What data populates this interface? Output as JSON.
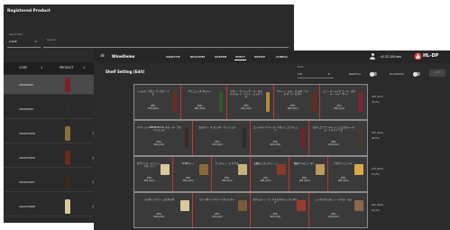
{
  "back_window": {
    "title": "Registered Product",
    "filter": {
      "type_label": "Search Field",
      "type_value": "CODE",
      "search_placeholder": "Search"
    },
    "table": {
      "columns": [
        "CODE",
        "PRODUCT"
      ],
      "rows": [
        {
          "code": "230400003",
          "name": "",
          "color": "#7a1f2b"
        },
        {
          "code": "230400005",
          "name": "",
          "color": "#2c2c2c"
        },
        {
          "code": "2022070008",
          "name": "アメリ",
          "color": "#8b6f3a"
        },
        {
          "code": "2022070006",
          "name": "スノイ",
          "color": "#6b2a1e"
        },
        {
          "code": "2022070007",
          "name": "カスデ",
          "color": "#3a2a1e"
        },
        {
          "code": "2022070008",
          "name": "カスデ",
          "color": "#d9c89a"
        }
      ]
    }
  },
  "front_window": {
    "app_title": "WineDemo",
    "nav": [
      "ANALYTIC",
      "REALTIME",
      "SCREEN",
      "SHELF",
      "DEVICE",
      "CONFIG"
    ],
    "active_nav": "SHELF",
    "user": "v2.33.105-dev",
    "brand": "HL-DP",
    "brand_color": "#e53935",
    "page_title": "Shelf Setting (Edit)",
    "mode": {
      "label": "Mode",
      "value": "1 E"
    },
    "toggles": [
      {
        "label": "RealTime"
      },
      {
        "label": "TouchMode"
      }
    ],
    "action_button": "SAVE",
    "height_label": "1845 (mm)",
    "shelves": [
      {
        "meta": [
          "475 (mm)",
          "33 (%)"
        ],
        "slots": [
          {
            "name": "シャルデ・グロン アングル・ナル",
            "pct": "20%",
            "width": "160 (mm)",
            "color": "#6b2a1e",
            "kind": "bottle"
          },
          {
            "name": "ヴァニュース ボルドー",
            "pct": "25%",
            "width": "160 (mm)",
            "color": "#2a5a2a",
            "kind": "bottle"
          },
          {
            "name": "ブロン・フィリップ ・デ・ロスチャイル ド・アンド・シャル ドネ",
            "pct": "25%",
            "width": "160 (mm)",
            "color": "#b88a3a",
            "kind": "bottle"
          },
          {
            "name": "アキーノ・デル・コ ルダ・ランデ グ リン ピクチ",
            "pct": "25%",
            "width": "180 (mm)",
            "color": "#6b2a1e",
            "kind": "bottle"
          },
          {
            "name": "ビノ・デ・ティエ ラ・デ・カステー リャ・ボーノ",
            "pct": "25%",
            "width": "160 (mm)",
            "color": "#8a1f2a",
            "kind": "bottle"
          }
        ]
      },
      {
        "meta": [
          "317 (mm)",
          "30 (%)"
        ],
        "slots": [
          {
            "name": "アウトシャ SIBERIAN V.G. ホス・デ・ラス ファミリス",
            "pct": "20%",
            "width": "240 (mm)",
            "color": "#3a2a1e",
            "kind": "bottle"
          },
          {
            "name": "カスデラ・ オ カ ルネ・アン ジ ョナ",
            "pct": "25%",
            "width": "210 (mm)",
            "color": "#2c2c2c",
            "kind": "bottle"
          },
          {
            "name": "エノイタリア ワー ズ・アセット ゴ ナチ ュラ",
            "pct": "25%",
            "width": "210 (mm)",
            "color": "#7a1f2b",
            "kind": "bottle"
          },
          {
            "name": "ロディエラ アンデリンーニ ビスクレーデル・ドゥラゾ リビ ",
            "pct": "25%",
            "width": "210 (mm)",
            "color": "#4a3a2a",
            "kind": "bottle"
          }
        ]
      },
      {
        "meta": [
          "274 (mm)",
          "15 (%)"
        ],
        "slots": [
          {
            "name": "ダヴァンナ・ミントン・ アガーソン",
            "pct": "25%",
            "width": "160 (mm)",
            "color": "#d9c89a",
            "kind": "box"
          },
          {
            "name": "18 樽ワイン",
            "pct": "20%",
            "width": "160 (mm)",
            "color": "#8a6a3a",
            "kind": "box"
          },
          {
            "name": "アンテイノ・ス ケアズ",
            "pct": "25%",
            "width": "160 (mm)",
            "color": "#c9b07a",
            "kind": "box"
          },
          {
            "name": "山田長 ミカンクリ ート",
            "pct": "25%",
            "width": "160 (mm)",
            "color": "#8a3a2a",
            "kind": "box"
          },
          {
            "name": "横屋ファビシン ター",
            "pct": "25%",
            "width": "160 (mm)",
            "color": "#b89a5a",
            "kind": "box"
          },
          {
            "name": "ブロヴァムニ デル ",
            "pct": "20%",
            "width": "160 (mm)",
            "color": "#d9a84a",
            "kind": "box"
          }
        ]
      },
      {
        "meta": [
          "221 (mm)",
          "14 (%)"
        ],
        "slots": [
          {
            "name": "メルガードヴァー ユスカイダ",
            "pct": "20%",
            "width": "210 (mm)",
            "color": "#d9c89a",
            "kind": "box"
          },
          {
            "name": "ロードボート サワ ーヤクラッカー",
            "pct": "25%",
            "width": "210 (mm)",
            "color": "#7a5a3a",
            "kind": "box"
          },
          {
            "name": "スパムヨーン アン チャビスキャン ゲンボーク",
            "pct": "25%",
            "width": "210 (mm)",
            "color": "#9a3a2a",
            "kind": "box"
          },
          {
            "name": "シングルケルストン ーナベル・モル",
            "pct": "25%",
            "width": "210 (mm)",
            "color": "#8a6a4a",
            "kind": "box"
          }
        ]
      }
    ]
  }
}
